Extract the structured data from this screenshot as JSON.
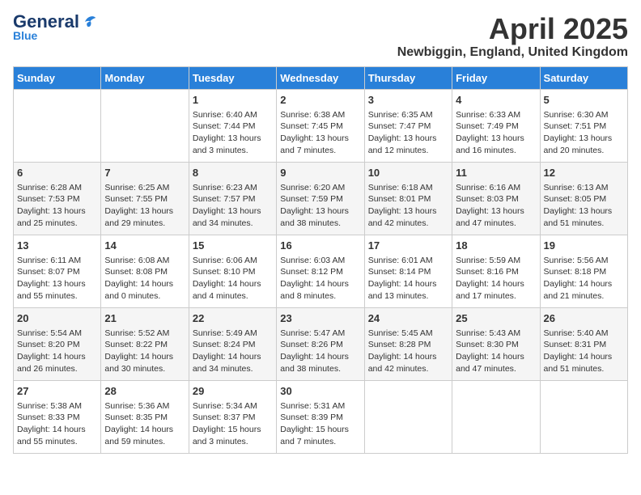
{
  "logo": {
    "general": "General",
    "blue": "Blue"
  },
  "title": "April 2025",
  "subtitle": "Newbiggin, England, United Kingdom",
  "weekdays": [
    "Sunday",
    "Monday",
    "Tuesday",
    "Wednesday",
    "Thursday",
    "Friday",
    "Saturday"
  ],
  "weeks": [
    [
      {
        "day": "",
        "info": ""
      },
      {
        "day": "",
        "info": ""
      },
      {
        "day": "1",
        "info": "Sunrise: 6:40 AM\nSunset: 7:44 PM\nDaylight: 13 hours and 3 minutes."
      },
      {
        "day": "2",
        "info": "Sunrise: 6:38 AM\nSunset: 7:45 PM\nDaylight: 13 hours and 7 minutes."
      },
      {
        "day": "3",
        "info": "Sunrise: 6:35 AM\nSunset: 7:47 PM\nDaylight: 13 hours and 12 minutes."
      },
      {
        "day": "4",
        "info": "Sunrise: 6:33 AM\nSunset: 7:49 PM\nDaylight: 13 hours and 16 minutes."
      },
      {
        "day": "5",
        "info": "Sunrise: 6:30 AM\nSunset: 7:51 PM\nDaylight: 13 hours and 20 minutes."
      }
    ],
    [
      {
        "day": "6",
        "info": "Sunrise: 6:28 AM\nSunset: 7:53 PM\nDaylight: 13 hours and 25 minutes."
      },
      {
        "day": "7",
        "info": "Sunrise: 6:25 AM\nSunset: 7:55 PM\nDaylight: 13 hours and 29 minutes."
      },
      {
        "day": "8",
        "info": "Sunrise: 6:23 AM\nSunset: 7:57 PM\nDaylight: 13 hours and 34 minutes."
      },
      {
        "day": "9",
        "info": "Sunrise: 6:20 AM\nSunset: 7:59 PM\nDaylight: 13 hours and 38 minutes."
      },
      {
        "day": "10",
        "info": "Sunrise: 6:18 AM\nSunset: 8:01 PM\nDaylight: 13 hours and 42 minutes."
      },
      {
        "day": "11",
        "info": "Sunrise: 6:16 AM\nSunset: 8:03 PM\nDaylight: 13 hours and 47 minutes."
      },
      {
        "day": "12",
        "info": "Sunrise: 6:13 AM\nSunset: 8:05 PM\nDaylight: 13 hours and 51 minutes."
      }
    ],
    [
      {
        "day": "13",
        "info": "Sunrise: 6:11 AM\nSunset: 8:07 PM\nDaylight: 13 hours and 55 minutes."
      },
      {
        "day": "14",
        "info": "Sunrise: 6:08 AM\nSunset: 8:08 PM\nDaylight: 14 hours and 0 minutes."
      },
      {
        "day": "15",
        "info": "Sunrise: 6:06 AM\nSunset: 8:10 PM\nDaylight: 14 hours and 4 minutes."
      },
      {
        "day": "16",
        "info": "Sunrise: 6:03 AM\nSunset: 8:12 PM\nDaylight: 14 hours and 8 minutes."
      },
      {
        "day": "17",
        "info": "Sunrise: 6:01 AM\nSunset: 8:14 PM\nDaylight: 14 hours and 13 minutes."
      },
      {
        "day": "18",
        "info": "Sunrise: 5:59 AM\nSunset: 8:16 PM\nDaylight: 14 hours and 17 minutes."
      },
      {
        "day": "19",
        "info": "Sunrise: 5:56 AM\nSunset: 8:18 PM\nDaylight: 14 hours and 21 minutes."
      }
    ],
    [
      {
        "day": "20",
        "info": "Sunrise: 5:54 AM\nSunset: 8:20 PM\nDaylight: 14 hours and 26 minutes."
      },
      {
        "day": "21",
        "info": "Sunrise: 5:52 AM\nSunset: 8:22 PM\nDaylight: 14 hours and 30 minutes."
      },
      {
        "day": "22",
        "info": "Sunrise: 5:49 AM\nSunset: 8:24 PM\nDaylight: 14 hours and 34 minutes."
      },
      {
        "day": "23",
        "info": "Sunrise: 5:47 AM\nSunset: 8:26 PM\nDaylight: 14 hours and 38 minutes."
      },
      {
        "day": "24",
        "info": "Sunrise: 5:45 AM\nSunset: 8:28 PM\nDaylight: 14 hours and 42 minutes."
      },
      {
        "day": "25",
        "info": "Sunrise: 5:43 AM\nSunset: 8:30 PM\nDaylight: 14 hours and 47 minutes."
      },
      {
        "day": "26",
        "info": "Sunrise: 5:40 AM\nSunset: 8:31 PM\nDaylight: 14 hours and 51 minutes."
      }
    ],
    [
      {
        "day": "27",
        "info": "Sunrise: 5:38 AM\nSunset: 8:33 PM\nDaylight: 14 hours and 55 minutes."
      },
      {
        "day": "28",
        "info": "Sunrise: 5:36 AM\nSunset: 8:35 PM\nDaylight: 14 hours and 59 minutes."
      },
      {
        "day": "29",
        "info": "Sunrise: 5:34 AM\nSunset: 8:37 PM\nDaylight: 15 hours and 3 minutes."
      },
      {
        "day": "30",
        "info": "Sunrise: 5:31 AM\nSunset: 8:39 PM\nDaylight: 15 hours and 7 minutes."
      },
      {
        "day": "",
        "info": ""
      },
      {
        "day": "",
        "info": ""
      },
      {
        "day": "",
        "info": ""
      }
    ]
  ]
}
